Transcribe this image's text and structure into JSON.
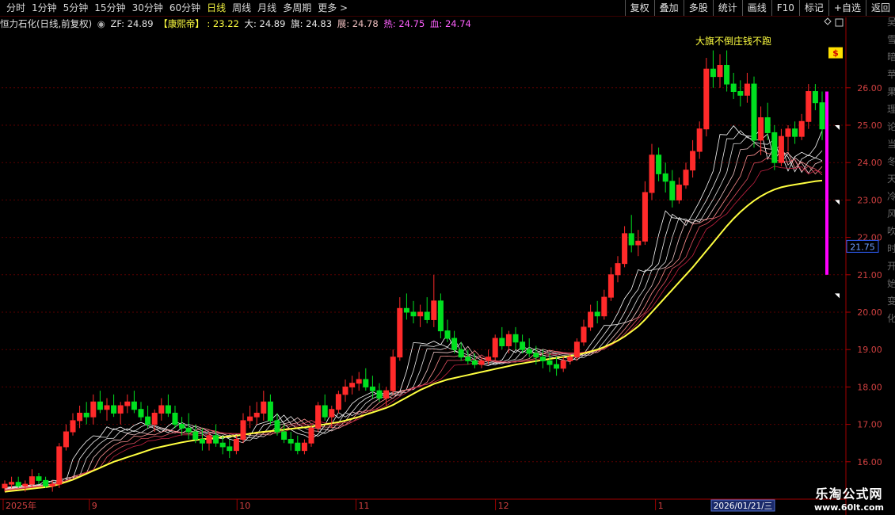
{
  "toolbar": {
    "periods": [
      "分时",
      "1分钟",
      "5分钟",
      "15分钟",
      "30分钟",
      "60分钟",
      "日线",
      "周线",
      "月线",
      "多周期",
      "更多 >"
    ],
    "active_period": "日线",
    "buttons": [
      "复权",
      "叠加",
      "多股",
      "统计",
      "画线",
      "F10",
      "标记",
      "+自选",
      "返回"
    ]
  },
  "info": {
    "stock": "恒力石化(日线,前复权)",
    "zf_label": "ZF: 24.89",
    "formula": "【康熙帝】",
    "v1": ": 23.22",
    "v2": "大: 24.89",
    "v3": "旗: 24.83",
    "v4": "展: 24.78",
    "v5": "热: 24.75",
    "v6": "血: 24.74"
  },
  "annotation": "大旗不倒庄钱不跑",
  "axis": {
    "labels": [
      "26.00",
      "25.00",
      "24.00",
      "23.00",
      "22.00",
      "21.00",
      "20.00",
      "19.00",
      "18.00",
      "17.00",
      "16.00"
    ],
    "current_price": "21.75",
    "right_edge_chars": [
      "吴",
      "雪",
      "暗",
      "苹",
      "果",
      "理",
      "论",
      "当",
      "冬",
      "天",
      "冷",
      "风",
      "吹",
      "时",
      "开",
      "始",
      "变",
      "化"
    ]
  },
  "dates": {
    "labels": [
      "2025年",
      "9",
      "10",
      "11",
      "12",
      "1"
    ],
    "cursor_date": "2026/01/21/三"
  },
  "watermark": {
    "line1": "乐淘公式网",
    "line2": "www.60lt.com"
  },
  "colors": {
    "up": "#ff2a2a",
    "down": "#00e020",
    "ma_yellow": "#ffff40",
    "magenta": "#ff00ff"
  },
  "chart_data": {
    "type": "candlestick",
    "ylim": [
      15.0,
      27.5
    ],
    "candles": [
      [
        15.3,
        15.5,
        15.2,
        15.4
      ],
      [
        15.4,
        15.6,
        15.3,
        15.45
      ],
      [
        15.45,
        15.6,
        15.3,
        15.35
      ],
      [
        15.35,
        15.5,
        15.2,
        15.4
      ],
      [
        15.4,
        15.8,
        15.3,
        15.6
      ],
      [
        15.6,
        15.7,
        15.4,
        15.5
      ],
      [
        15.5,
        15.6,
        15.3,
        15.35
      ],
      [
        15.35,
        15.5,
        15.2,
        15.4
      ],
      [
        15.4,
        16.5,
        15.3,
        16.4
      ],
      [
        16.4,
        17.0,
        16.3,
        16.8
      ],
      [
        16.8,
        17.3,
        16.7,
        17.1
      ],
      [
        17.1,
        17.5,
        16.9,
        17.3
      ],
      [
        17.3,
        17.6,
        17.0,
        17.2
      ],
      [
        17.2,
        17.8,
        17.0,
        17.6
      ],
      [
        17.6,
        17.9,
        17.3,
        17.4
      ],
      [
        17.4,
        17.7,
        17.1,
        17.5
      ],
      [
        17.5,
        17.8,
        17.2,
        17.3
      ],
      [
        17.3,
        17.6,
        17.0,
        17.5
      ],
      [
        17.5,
        17.8,
        17.3,
        17.6
      ],
      [
        17.6,
        17.9,
        17.3,
        17.4
      ],
      [
        17.4,
        17.6,
        17.1,
        17.2
      ],
      [
        17.2,
        17.5,
        16.9,
        17.0
      ],
      [
        17.0,
        17.4,
        16.8,
        17.3
      ],
      [
        17.3,
        17.7,
        17.1,
        17.5
      ],
      [
        17.5,
        17.8,
        17.2,
        17.3
      ],
      [
        17.3,
        17.5,
        16.9,
        17.0
      ],
      [
        17.0,
        17.2,
        16.7,
        16.9
      ],
      [
        16.9,
        17.3,
        16.6,
        16.8
      ],
      [
        16.8,
        17.0,
        16.5,
        16.6
      ],
      [
        16.6,
        16.9,
        16.3,
        16.5
      ],
      [
        16.5,
        16.8,
        16.3,
        16.7
      ],
      [
        16.7,
        17.0,
        16.4,
        16.5
      ],
      [
        16.5,
        16.7,
        16.2,
        16.4
      ],
      [
        16.4,
        16.6,
        16.1,
        16.3
      ],
      [
        16.3,
        16.7,
        16.2,
        16.6
      ],
      [
        16.6,
        17.3,
        16.5,
        17.1
      ],
      [
        17.1,
        17.5,
        16.9,
        17.2
      ],
      [
        17.2,
        17.6,
        17.0,
        17.3
      ],
      [
        17.3,
        17.9,
        17.1,
        17.6
      ],
      [
        17.6,
        17.8,
        17.0,
        17.1
      ],
      [
        17.1,
        17.3,
        16.7,
        16.8
      ],
      [
        16.8,
        17.0,
        16.5,
        16.6
      ],
      [
        16.6,
        16.8,
        16.3,
        16.5
      ],
      [
        16.5,
        16.7,
        16.2,
        16.3
      ],
      [
        16.3,
        16.6,
        16.2,
        16.5
      ],
      [
        16.5,
        17.0,
        16.4,
        16.9
      ],
      [
        16.9,
        17.6,
        16.8,
        17.5
      ],
      [
        17.5,
        17.8,
        17.1,
        17.2
      ],
      [
        17.2,
        17.5,
        16.9,
        17.4
      ],
      [
        17.4,
        17.9,
        17.3,
        17.8
      ],
      [
        17.8,
        18.2,
        17.6,
        18.0
      ],
      [
        18.0,
        18.3,
        17.8,
        18.1
      ],
      [
        18.1,
        18.4,
        17.9,
        18.2
      ],
      [
        18.2,
        18.5,
        17.9,
        18.0
      ],
      [
        18.0,
        18.3,
        17.7,
        17.9
      ],
      [
        17.9,
        18.1,
        17.6,
        17.7
      ],
      [
        17.7,
        18.0,
        17.5,
        17.9
      ],
      [
        17.9,
        19.0,
        17.8,
        18.8
      ],
      [
        18.8,
        20.4,
        18.7,
        20.1
      ],
      [
        20.1,
        20.5,
        19.8,
        20.0
      ],
      [
        20.0,
        20.3,
        19.7,
        19.9
      ],
      [
        19.9,
        20.2,
        19.6,
        20.0
      ],
      [
        20.0,
        20.4,
        19.7,
        19.8
      ],
      [
        19.8,
        21.0,
        19.6,
        20.3
      ],
      [
        20.3,
        20.5,
        19.3,
        19.5
      ],
      [
        19.5,
        19.8,
        19.2,
        19.3
      ],
      [
        19.3,
        19.5,
        18.9,
        19.0
      ],
      [
        19.0,
        19.2,
        18.7,
        18.8
      ],
      [
        18.8,
        19.0,
        18.6,
        18.7
      ],
      [
        18.7,
        18.9,
        18.5,
        18.6
      ],
      [
        18.6,
        18.8,
        18.5,
        18.7
      ],
      [
        18.7,
        19.0,
        18.6,
        18.8
      ],
      [
        18.8,
        19.4,
        18.7,
        19.3
      ],
      [
        19.3,
        19.6,
        19.0,
        19.1
      ],
      [
        19.1,
        19.5,
        18.9,
        19.4
      ],
      [
        19.4,
        19.6,
        19.0,
        19.2
      ],
      [
        19.2,
        19.4,
        18.9,
        19.0
      ],
      [
        19.0,
        19.3,
        18.8,
        18.9
      ],
      [
        18.9,
        19.1,
        18.6,
        18.8
      ],
      [
        18.8,
        19.0,
        18.5,
        18.7
      ],
      [
        18.7,
        18.9,
        18.4,
        18.6
      ],
      [
        18.6,
        18.8,
        18.3,
        18.5
      ],
      [
        18.5,
        18.8,
        18.4,
        18.7
      ],
      [
        18.7,
        18.9,
        18.6,
        18.8
      ],
      [
        18.8,
        19.3,
        18.7,
        19.2
      ],
      [
        19.2,
        19.8,
        19.1,
        19.6
      ],
      [
        19.6,
        20.2,
        19.5,
        20.0
      ],
      [
        20.0,
        20.3,
        19.7,
        19.9
      ],
      [
        19.9,
        20.6,
        19.8,
        20.4
      ],
      [
        20.4,
        21.2,
        20.3,
        21.0
      ],
      [
        21.0,
        21.5,
        20.8,
        21.3
      ],
      [
        21.3,
        22.3,
        21.2,
        22.1
      ],
      [
        22.1,
        22.6,
        21.6,
        21.8
      ],
      [
        21.8,
        22.2,
        21.5,
        21.9
      ],
      [
        21.9,
        23.5,
        21.8,
        23.2
      ],
      [
        23.2,
        24.5,
        23.0,
        24.2
      ],
      [
        24.2,
        24.4,
        23.5,
        23.7
      ],
      [
        23.7,
        24.0,
        23.2,
        23.5
      ],
      [
        23.5,
        23.8,
        22.8,
        23.0
      ],
      [
        23.0,
        23.6,
        22.9,
        23.4
      ],
      [
        23.4,
        24.0,
        23.3,
        23.8
      ],
      [
        23.8,
        24.6,
        23.6,
        24.3
      ],
      [
        24.3,
        25.1,
        24.1,
        24.9
      ],
      [
        24.9,
        26.8,
        24.7,
        26.5
      ],
      [
        26.5,
        27.0,
        26.0,
        26.3
      ],
      [
        26.3,
        26.9,
        26.0,
        26.6
      ],
      [
        26.6,
        27.0,
        25.9,
        26.1
      ],
      [
        26.1,
        26.4,
        25.7,
        25.9
      ],
      [
        25.9,
        26.2,
        25.5,
        25.8
      ],
      [
        25.8,
        26.4,
        25.6,
        26.1
      ],
      [
        26.1,
        26.3,
        24.4,
        24.6
      ],
      [
        24.6,
        25.5,
        24.2,
        25.2
      ],
      [
        25.2,
        25.6,
        24.6,
        24.8
      ],
      [
        24.8,
        25.0,
        23.8,
        24.0
      ],
      [
        24.0,
        24.9,
        23.9,
        24.7
      ],
      [
        24.7,
        25.0,
        24.3,
        24.9
      ],
      [
        24.9,
        25.1,
        24.5,
        24.7
      ],
      [
        24.7,
        25.3,
        24.6,
        25.1
      ],
      [
        25.1,
        26.1,
        24.9,
        25.9
      ],
      [
        25.9,
        26.1,
        25.4,
        25.6
      ],
      [
        25.6,
        25.9,
        24.6,
        24.9
      ]
    ],
    "ma_main": [
      15.2,
      15.22,
      15.24,
      15.26,
      15.28,
      15.3,
      15.32,
      15.35,
      15.4,
      15.46,
      15.52,
      15.6,
      15.68,
      15.76,
      15.84,
      15.92,
      16.0,
      16.06,
      16.12,
      16.18,
      16.24,
      16.3,
      16.36,
      16.4,
      16.44,
      16.48,
      16.52,
      16.55,
      16.58,
      16.6,
      16.62,
      16.64,
      16.66,
      16.68,
      16.7,
      16.72,
      16.75,
      16.78,
      16.8,
      16.82,
      16.84,
      16.86,
      16.88,
      16.9,
      16.92,
      16.94,
      16.97,
      17.0,
      17.03,
      17.06,
      17.1,
      17.15,
      17.2,
      17.26,
      17.32,
      17.38,
      17.44,
      17.52,
      17.62,
      17.72,
      17.82,
      17.92,
      18.0,
      18.08,
      18.14,
      18.2,
      18.24,
      18.28,
      18.32,
      18.36,
      18.4,
      18.44,
      18.48,
      18.52,
      18.56,
      18.6,
      18.63,
      18.66,
      18.69,
      18.72,
      18.75,
      18.78,
      18.8,
      18.83,
      18.86,
      18.9,
      18.95,
      19.0,
      19.07,
      19.15,
      19.24,
      19.35,
      19.48,
      19.62,
      19.8,
      20.0,
      20.2,
      20.4,
      20.6,
      20.8,
      21.0,
      21.2,
      21.42,
      21.64,
      21.86,
      22.08,
      22.3,
      22.5,
      22.68,
      22.84,
      22.98,
      23.1,
      23.2,
      23.28,
      23.34,
      23.38,
      23.41,
      23.44,
      23.47,
      23.5,
      23.52
    ],
    "bands": [
      0.0,
      0.4,
      0.8,
      1.2,
      1.6,
      2.0,
      2.4
    ]
  },
  "markers": {
    "signal_label": "$",
    "magenta_range": [
      21.0,
      27.0
    ]
  }
}
